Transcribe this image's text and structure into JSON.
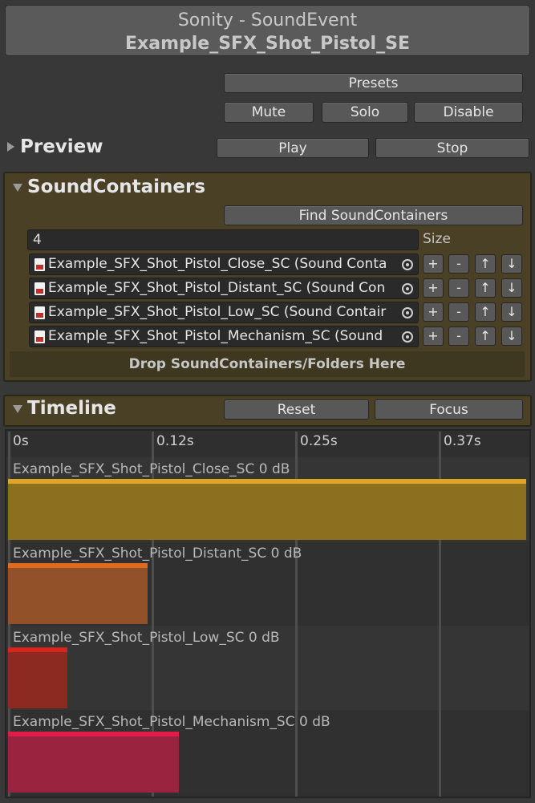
{
  "header": {
    "title_line1": "Sonity - SoundEvent",
    "title_line2": "Example_SFX_Shot_Pistol_SE"
  },
  "buttons": {
    "presets": "Presets",
    "mute": "Mute",
    "solo": "Solo",
    "disable": "Disable",
    "play": "Play",
    "stop": "Stop",
    "find_sound_containers": "Find SoundContainers",
    "reset": "Reset",
    "focus": "Focus"
  },
  "preview": {
    "title": "Preview"
  },
  "sound_containers": {
    "title": "SoundContainers",
    "size_value": "4",
    "size_label": "Size",
    "items": [
      {
        "label": "Example_SFX_Shot_Pistol_Close_SC (Sound Conta"
      },
      {
        "label": "Example_SFX_Shot_Pistol_Distant_SC (Sound Con"
      },
      {
        "label": "Example_SFX_Shot_Pistol_Low_SC (Sound Contair"
      },
      {
        "label": "Example_SFX_Shot_Pistol_Mechanism_SC (Sound"
      }
    ],
    "row_buttons": {
      "add": "+",
      "remove": "-",
      "up": "↑",
      "down": "↓"
    },
    "drop_text": "Drop SoundContainers/Folders Here"
  },
  "timeline": {
    "title": "Timeline",
    "ticks": [
      "0s",
      "0.12s",
      "0.25s",
      "0.37s"
    ],
    "tracks": [
      {
        "label": "Example_SFX_Shot_Pistol_Close_SC 0 dB",
        "length_fraction": 1.0,
        "color": "#8c7020",
        "accent": "#e0a426"
      },
      {
        "label": "Example_SFX_Shot_Pistol_Distant_SC 0 dB",
        "length_fraction": 0.27,
        "color": "#93512a",
        "accent": "#e06a1e"
      },
      {
        "label": "Example_SFX_Shot_Pistol_Low_SC 0 dB",
        "length_fraction": 0.115,
        "color": "#8c2a22",
        "accent": "#d8241c"
      },
      {
        "label": "Example_SFX_Shot_Pistol_Mechanism_SC 0 dB",
        "length_fraction": 0.33,
        "color": "#9a2440",
        "accent": "#e01c48"
      }
    ]
  },
  "colors": {
    "background": "#383838",
    "section_panel": "#4a4026",
    "button": "#585858"
  },
  "icons": {
    "preview_toggle": "triangle-right-icon",
    "containers_toggle": "triangle-down-icon",
    "timeline_toggle": "triangle-down-icon",
    "object_icon": "sound-container-file-icon",
    "object_picker": "object-picker-icon"
  }
}
